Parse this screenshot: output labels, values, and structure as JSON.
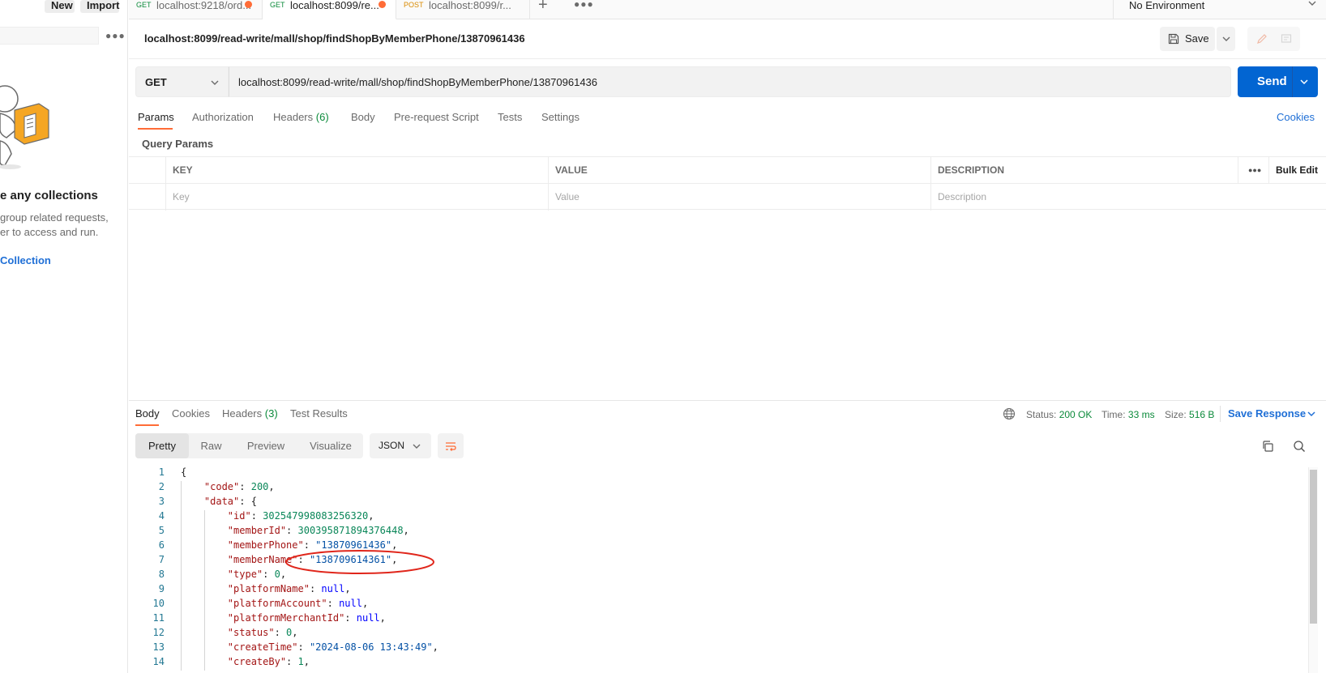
{
  "sidebar": {
    "new_label": "New",
    "import_label": "Import",
    "empty_title": "e any collections",
    "empty_line1": "group related requests,",
    "empty_line2": "er to access and run.",
    "create_link": "Collection"
  },
  "tabs": [
    {
      "method": "GET",
      "title": "localhost:9218/ord...",
      "method_color": "#0b8a3a"
    },
    {
      "method": "GET",
      "title": "localhost:8099/re...",
      "method_color": "#0b8a3a"
    },
    {
      "method": "POST",
      "title": "localhost:8099/r...",
      "method_color": "#d98a00"
    }
  ],
  "environment": "No Environment",
  "request": {
    "title": "localhost:8099/read-write/mall/shop/findShopByMemberPhone/13870961436",
    "save_label": "Save",
    "method": "GET",
    "url": "localhost:8099/read-write/mall/shop/findShopByMemberPhone/13870961436",
    "send_label": "Send"
  },
  "request_tabs": {
    "params": "Params",
    "authorization": "Authorization",
    "headers": "Headers",
    "headers_count": "(6)",
    "body": "Body",
    "pre_request": "Pre-request Script",
    "tests": "Tests",
    "settings": "Settings",
    "cookies": "Cookies"
  },
  "query_params": {
    "label": "Query Params",
    "columns": [
      "KEY",
      "VALUE",
      "DESCRIPTION"
    ],
    "bulk_edit": "Bulk Edit",
    "placeholders": [
      "Key",
      "Value",
      "Description"
    ]
  },
  "response": {
    "tabs": {
      "body": "Body",
      "cookies": "Cookies",
      "headers": "Headers",
      "headers_count": "(3)",
      "test_results": "Test Results"
    },
    "status_label": "Status:",
    "status_value": "200 OK",
    "time_label": "Time:",
    "time_value": "33 ms",
    "size_label": "Size:",
    "size_value": "516 B",
    "save_response": "Save Response",
    "views": [
      "Pretty",
      "Raw",
      "Preview",
      "Visualize"
    ],
    "format": "JSON"
  },
  "code_lines": [
    {
      "n": "1",
      "tokens": [
        [
          "p",
          "{"
        ]
      ]
    },
    {
      "n": "2",
      "tokens": [
        [
          "p",
          "    "
        ],
        [
          "k",
          "\"code\""
        ],
        [
          "p",
          ": "
        ],
        [
          "n",
          "200"
        ],
        [
          "p",
          ","
        ]
      ]
    },
    {
      "n": "3",
      "tokens": [
        [
          "p",
          "    "
        ],
        [
          "k",
          "\"data\""
        ],
        [
          "p",
          ": {"
        ]
      ]
    },
    {
      "n": "4",
      "tokens": [
        [
          "p",
          "        "
        ],
        [
          "k",
          "\"id\""
        ],
        [
          "p",
          ": "
        ],
        [
          "n",
          "302547998083256320"
        ],
        [
          "p",
          ","
        ]
      ]
    },
    {
      "n": "5",
      "tokens": [
        [
          "p",
          "        "
        ],
        [
          "k",
          "\"memberId\""
        ],
        [
          "p",
          ": "
        ],
        [
          "n",
          "300395871894376448"
        ],
        [
          "p",
          ","
        ]
      ]
    },
    {
      "n": "6",
      "tokens": [
        [
          "p",
          "        "
        ],
        [
          "k",
          "\"memberPhone\""
        ],
        [
          "p",
          ": "
        ],
        [
          "s",
          "\"13870961436\""
        ],
        [
          "p",
          ","
        ]
      ]
    },
    {
      "n": "7",
      "tokens": [
        [
          "p",
          "        "
        ],
        [
          "k",
          "\"memberName\""
        ],
        [
          "p",
          ": "
        ],
        [
          "s",
          "\"138709614361\""
        ],
        [
          "p",
          ","
        ]
      ]
    },
    {
      "n": "8",
      "tokens": [
        [
          "p",
          "        "
        ],
        [
          "k",
          "\"type\""
        ],
        [
          "p",
          ": "
        ],
        [
          "n",
          "0"
        ],
        [
          "p",
          ","
        ]
      ]
    },
    {
      "n": "9",
      "tokens": [
        [
          "p",
          "        "
        ],
        [
          "k",
          "\"platformName\""
        ],
        [
          "p",
          ": "
        ],
        [
          "kw",
          "null"
        ],
        [
          "p",
          ","
        ]
      ]
    },
    {
      "n": "10",
      "tokens": [
        [
          "p",
          "        "
        ],
        [
          "k",
          "\"platformAccount\""
        ],
        [
          "p",
          ": "
        ],
        [
          "kw",
          "null"
        ],
        [
          "p",
          ","
        ]
      ]
    },
    {
      "n": "11",
      "tokens": [
        [
          "p",
          "        "
        ],
        [
          "k",
          "\"platformMerchantId\""
        ],
        [
          "p",
          ": "
        ],
        [
          "kw",
          "null"
        ],
        [
          "p",
          ","
        ]
      ]
    },
    {
      "n": "12",
      "tokens": [
        [
          "p",
          "        "
        ],
        [
          "k",
          "\"status\""
        ],
        [
          "p",
          ": "
        ],
        [
          "n",
          "0"
        ],
        [
          "p",
          ","
        ]
      ]
    },
    {
      "n": "13",
      "tokens": [
        [
          "p",
          "        "
        ],
        [
          "k",
          "\"createTime\""
        ],
        [
          "p",
          ": "
        ],
        [
          "s",
          "\"2024-08-06 13:43:49\""
        ],
        [
          "p",
          ","
        ]
      ]
    },
    {
      "n": "14",
      "tokens": [
        [
          "p",
          "        "
        ],
        [
          "k",
          "\"createBy\""
        ],
        [
          "p",
          ": "
        ],
        [
          "n",
          "1"
        ],
        [
          "p",
          ","
        ]
      ]
    }
  ],
  "colors": {
    "accent_orange": "#ff6c37",
    "send_blue": "#0265d2",
    "link_blue": "#1f6fd6",
    "status_green": "#0b8a3a",
    "annotation_red": "#e0261b"
  }
}
